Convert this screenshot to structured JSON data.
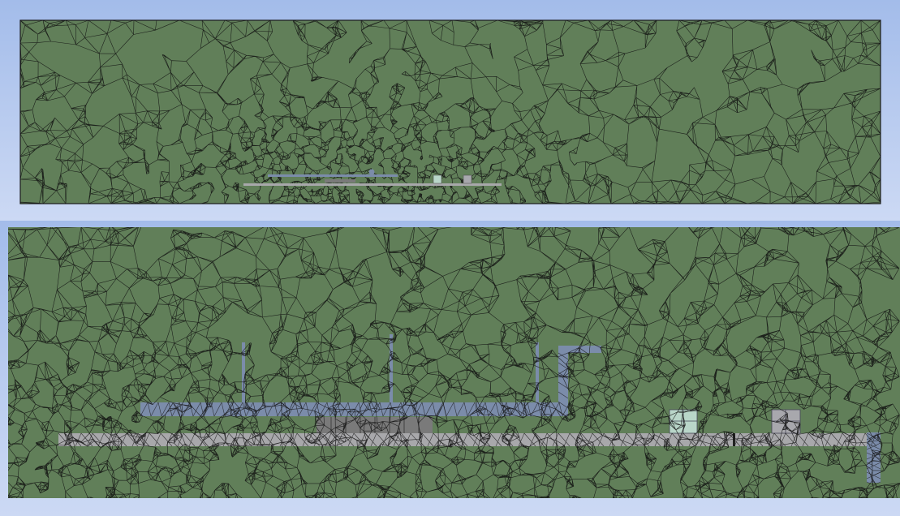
{
  "colors": {
    "gradient_top": "#a3bcea",
    "gradient_bottom": "#ccd9f4",
    "fluid_domain": "#617f59",
    "mesh_line": "#111111",
    "domain_border": "#1a1a1a",
    "substrate": "#a8a8ab",
    "manifold": "#7b8caa",
    "chip": "#7a7a7a",
    "component_green": "#b9d6c9",
    "component_gray": "#a8a8ad"
  },
  "views": [
    {
      "name": "overview",
      "description_label": ""
    },
    {
      "name": "zoomed-detail",
      "description_label": ""
    }
  ],
  "bodies": [
    {
      "name": "fluid-domain"
    },
    {
      "name": "substrate-plate"
    },
    {
      "name": "gas-manifold"
    },
    {
      "name": "heater-chip-block"
    },
    {
      "name": "component-block-green"
    },
    {
      "name": "component-block-gray"
    },
    {
      "name": "vertical-support"
    }
  ]
}
